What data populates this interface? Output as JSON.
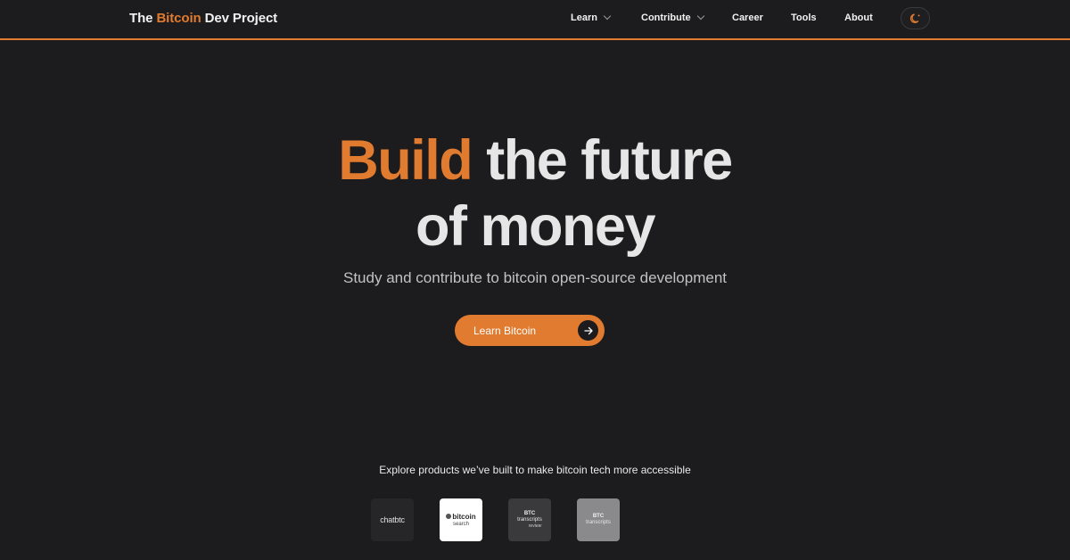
{
  "header": {
    "brand": {
      "prefix": "The ",
      "accent": "Bitcoin",
      "suffix": " Dev Project"
    },
    "nav": {
      "learn": "Learn",
      "contribute": "Contribute",
      "career": "Career",
      "tools": "Tools",
      "about": "About"
    },
    "theme_toggle_icon": "moon-sparkle-icon"
  },
  "hero": {
    "title_accent": "Build",
    "title_rest": " the future",
    "title_line2": "of money",
    "subtitle": "Study and contribute to bitcoin open-source development",
    "cta_label": "Learn Bitcoin",
    "cta_icon": "arrow-right-icon"
  },
  "products": {
    "intro": "Explore products we’ve built to make bitcoin tech more accessible",
    "items": [
      {
        "name": "chatbtc",
        "text": "chatbtc"
      },
      {
        "name": "bitcoin search",
        "top": "bitcoin",
        "bottom": "search"
      },
      {
        "name": "BTC transcripts review",
        "top": "BTC",
        "middle": "transcripts",
        "bottom": "review"
      },
      {
        "name": "BTC transcripts",
        "top": "BTC",
        "bottom": "transcripts"
      }
    ]
  },
  "colors": {
    "background": "#1c1b1d",
    "accent": "#e07b2f",
    "text": "#e6e6e6"
  }
}
